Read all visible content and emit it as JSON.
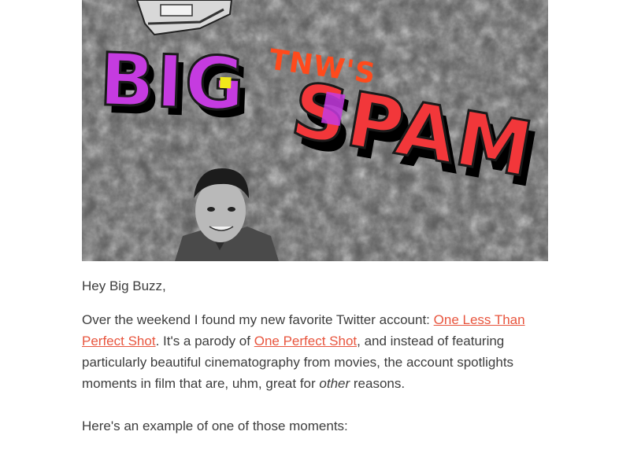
{
  "hero": {
    "title_small": "TNW'S",
    "title_big": "BIG",
    "title_spam": "SPAM",
    "colors": {
      "magenta": "#c53be0",
      "red": "#f2373a",
      "orange": "#ff4a1c",
      "yellow": "#f0e81a",
      "shadow": "#000000"
    }
  },
  "email": {
    "greeting": "Hey Big Buzz,",
    "para1": {
      "t1": "Over the weekend I found my new favorite Twitter account: ",
      "link1": "One Less Than Perfect Shot",
      "t2": ". It's a parody of ",
      "link2": "One Perfect Shot",
      "t3": ", and instead of featuring particularly beautiful cinematography from movies, the account spotlights moments in film that are, uhm, great for ",
      "em": "other",
      "t4": " reasons."
    },
    "para2": "Here's an example of one of those moments:"
  }
}
